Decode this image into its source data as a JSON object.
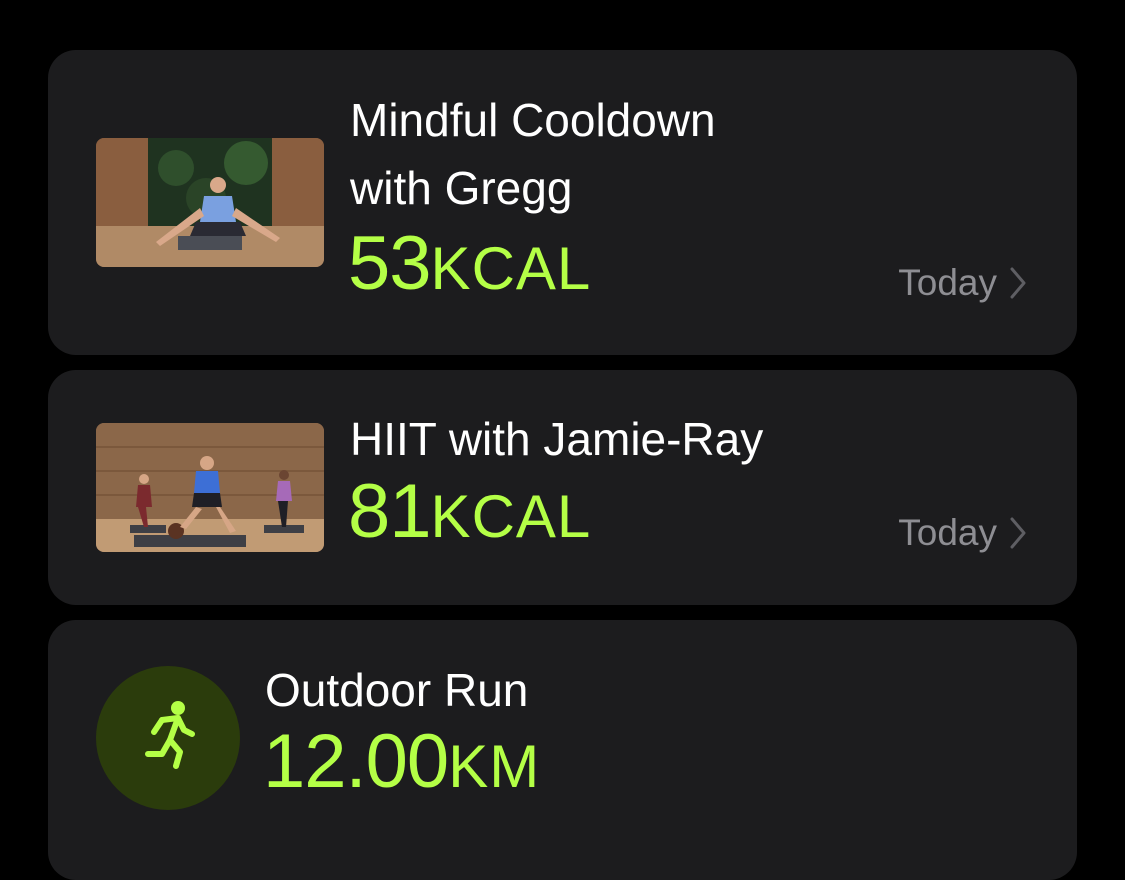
{
  "workouts": [
    {
      "title": "Mindful Cooldown\nwith Gregg",
      "value": "53",
      "unit": "KCAL",
      "date": "Today",
      "thumbnail_icon": "video-thumbnail-cooldown"
    },
    {
      "title": "HIIT with Jamie-Ray",
      "value": "81",
      "unit": "KCAL",
      "date": "Today",
      "thumbnail_icon": "video-thumbnail-hiit"
    },
    {
      "title": "Outdoor Run",
      "value": "12.00",
      "unit": "KM",
      "icon": "running-figure-icon"
    }
  ],
  "colors": {
    "accent": "#b4ff46",
    "card": "#1c1c1e",
    "secondary_text": "#8e8e93"
  }
}
